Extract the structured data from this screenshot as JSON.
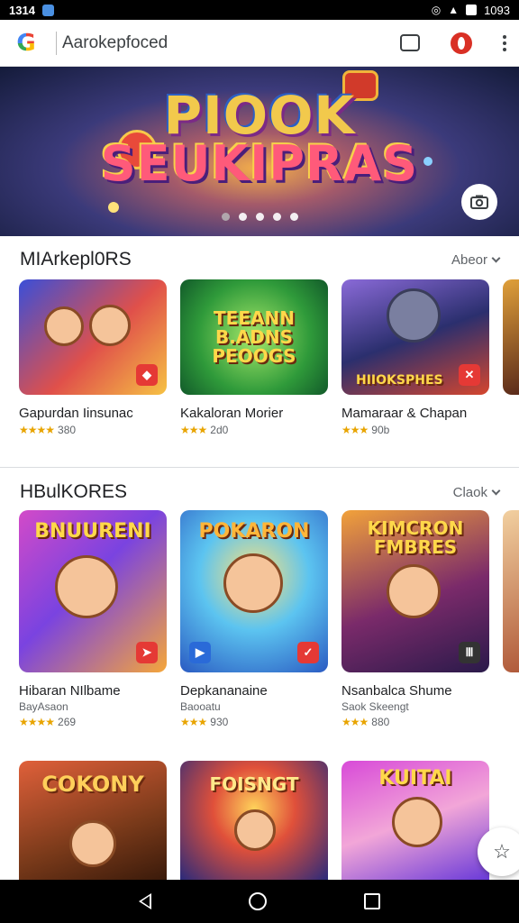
{
  "status_bar": {
    "time": "1314",
    "right_text": "1093"
  },
  "browser": {
    "address": "Aarokepfoced"
  },
  "hero": {
    "line1": "PIOOK",
    "line2": "SEUKIPRAS",
    "dots": 5,
    "active_dot": 1
  },
  "sections": [
    {
      "title": "MIArkepl0RS",
      "more_label": "Abeor",
      "cards": [
        {
          "name": "Gapurdan Iinsunac",
          "rating_text": "380",
          "stars": "★★★★",
          "art_text": "",
          "bg": "linear-gradient(135deg,#3a4fd8,#e0504a 55%,#f6c244)"
        },
        {
          "name": "Kakaloran Morier",
          "rating_text": "2d0",
          "stars": "★★★",
          "art_text": "TEEANN\nB.ADNS\nPEOOGS",
          "bg": "radial-gradient(circle at 50% 50%,#a6e86a,#2f9a3a 60%,#125a2a)"
        },
        {
          "name": "Mamaraar & Chapan",
          "rating_text": "90b",
          "stars": "★★★",
          "art_text": "HIIOKSPHES",
          "bg": "linear-gradient(160deg,#8a6ad8,#2b2f6e 50%,#d5462e)"
        }
      ]
    },
    {
      "title": "HBulKORES",
      "more_label": "Claok",
      "cards": [
        {
          "name": "Hibaran NIlbame",
          "sub": "BayAsaon",
          "rating_text": "269",
          "stars": "★★★★",
          "art_text": "BNUURENI",
          "bg": "linear-gradient(135deg,#d34ac8,#7a43e0 45%,#f5a63a)"
        },
        {
          "name": "Depkananaine",
          "sub": "Baooatu",
          "rating_text": "930",
          "stars": "★★★",
          "art_text": "POKARON",
          "bg": "radial-gradient(circle at 50% 40%,#ffe27a,#5cc4f0 45%,#2a5ac2)"
        },
        {
          "name": "Nsanbalca Shume",
          "sub": "Saok Skeengt",
          "rating_text": "880",
          "stars": "★★★",
          "art_text": "KIMCRON\nFMBRES",
          "bg": "linear-gradient(160deg,#f2a23a,#7a2a6a 55%,#2a1a4a)"
        }
      ]
    },
    {
      "title": "",
      "more_label": "",
      "cards": [
        {
          "name": "",
          "art_text": "COKONY",
          "bg": "linear-gradient(160deg,#e0603a,#7a3a1a 60%,#3a1a0a)"
        },
        {
          "name": "",
          "art_text": "FOISNGT",
          "bg": "radial-gradient(circle at 50% 40%,#ffd25a,#e0503a 40%,#2a2a7a)"
        },
        {
          "name": "",
          "art_text": "KUITAI",
          "bg": "linear-gradient(160deg,#d84ad8,#f2a6d8 50%,#6a3ad8)"
        }
      ]
    }
  ],
  "colors": {
    "accent_red": "#e53935",
    "star": "#e8a400",
    "divider": "#dadce0"
  },
  "icons": [
    "google-logo-icon",
    "tabs-icon",
    "account-icon",
    "menu-icon",
    "camera-icon",
    "back-icon",
    "home-icon",
    "recents-icon",
    "star-fab-icon"
  ]
}
